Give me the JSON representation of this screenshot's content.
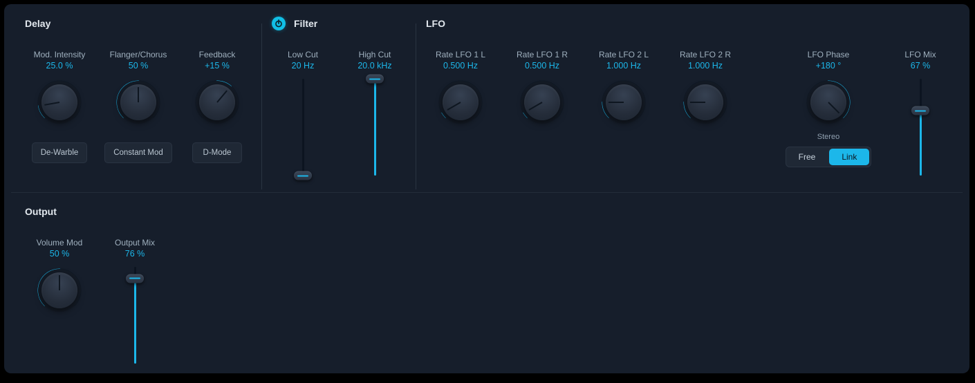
{
  "accent": "#1cb7ea",
  "sections": {
    "delay": {
      "title": "Delay",
      "controls": {
        "mod_intensity": {
          "label": "Mod. Intensity",
          "value": "25.0 %",
          "angle": -100,
          "arc_start": -135,
          "arc_end": -100,
          "button": "De-Warble"
        },
        "flanger_chorus": {
          "label": "Flanger/Chorus",
          "value": "50 %",
          "angle": 0,
          "arc_start": -135,
          "arc_end": 0,
          "button": "Constant Mod"
        },
        "feedback": {
          "label": "Feedback",
          "value": "+15 %",
          "angle": 40,
          "arc_start": 0,
          "arc_end": 40,
          "button": "D-Mode"
        }
      }
    },
    "filter": {
      "title": "Filter",
      "power": true,
      "controls": {
        "low_cut": {
          "label": "Low Cut",
          "value": "20 Hz",
          "slider_pct": 0
        },
        "high_cut": {
          "label": "High Cut",
          "value": "20.0 kHz",
          "slider_pct": 100
        }
      }
    },
    "lfo": {
      "title": "LFO",
      "controls": {
        "rate_lfo_1l": {
          "label": "Rate LFO 1 L",
          "value": "0.500 Hz",
          "angle": -120,
          "arc_start": -135,
          "arc_end": -120
        },
        "rate_lfo_1r": {
          "label": "Rate LFO 1 R",
          "value": "0.500 Hz",
          "angle": -120,
          "arc_start": -135,
          "arc_end": -120
        },
        "rate_lfo_2l": {
          "label": "Rate LFO 2 L",
          "value": "1.000 Hz",
          "angle": -90,
          "arc_start": -135,
          "arc_end": -90
        },
        "rate_lfo_2r": {
          "label": "Rate LFO 2 R",
          "value": "1.000 Hz",
          "angle": -90,
          "arc_start": -135,
          "arc_end": -90
        },
        "lfo_phase": {
          "label": "LFO Phase",
          "value": "+180 °",
          "angle": 135,
          "arc_start": 0,
          "arc_end": 135
        },
        "lfo_mix": {
          "label": "LFO Mix",
          "value": "67 %",
          "slider_pct": 67
        }
      },
      "stereo": {
        "label": "Stereo",
        "options": [
          "Free",
          "Link"
        ],
        "active": "Link"
      }
    },
    "output": {
      "title": "Output",
      "controls": {
        "volume_mod": {
          "label": "Volume Mod",
          "value": "50 %",
          "angle": 0,
          "arc_start": -135,
          "arc_end": 0
        },
        "output_mix": {
          "label": "Output Mix",
          "value": "76 %",
          "slider_pct": 88
        }
      }
    }
  }
}
